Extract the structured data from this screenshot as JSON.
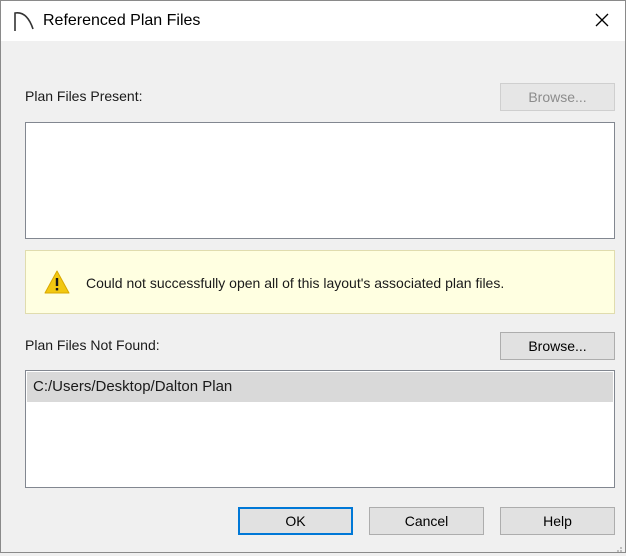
{
  "dialog": {
    "title": "Referenced Plan Files",
    "close_icon": "close-icon",
    "app_icon": "arc-icon"
  },
  "present": {
    "label": "Plan Files Present:",
    "browse_label": "Browse...",
    "browse_enabled": false,
    "items": []
  },
  "warning": {
    "icon": "warning-icon",
    "message": "Could not successfully open all of this layout's associated plan files."
  },
  "not_found": {
    "label": "Plan Files Not Found:",
    "browse_label": "Browse...",
    "items": [
      "C:/Users/Desktop/Dalton Plan"
    ]
  },
  "buttons": {
    "ok": "OK",
    "cancel": "Cancel",
    "help": "Help"
  },
  "colors": {
    "warning_bg": "#ffffe1",
    "warning_icon": "#f2c811",
    "selection": "#d9d9d9",
    "default_button_border": "#0078d7"
  }
}
